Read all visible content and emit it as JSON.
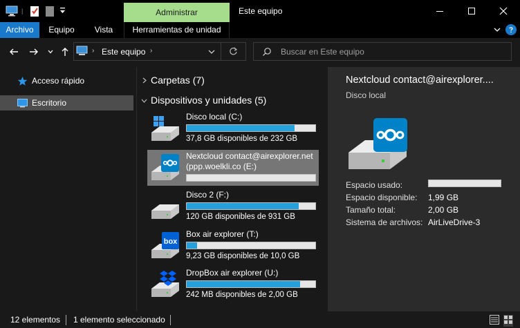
{
  "titlebar": {
    "title": "Este equipo",
    "context_tab": "Administrar",
    "icons": [
      "computer-icon",
      "properties-icon",
      "new-folder-icon",
      "customize-quick-access-icon"
    ],
    "window_buttons": [
      "minimize-icon",
      "maximize-icon",
      "close-icon"
    ]
  },
  "ribbon": {
    "tabs": [
      {
        "label": "Archivo",
        "active": true
      },
      {
        "label": "Equipo"
      },
      {
        "label": "Vista"
      },
      {
        "label": "Herramientas de unidad"
      }
    ]
  },
  "address": {
    "path_label": "Este equipo",
    "search_placeholder": "Buscar en Este equipo"
  },
  "nav": {
    "items": [
      {
        "label": "Acceso rápido",
        "icon": "star-icon"
      },
      {
        "label": "Escritorio",
        "icon": "desktop-icon",
        "selected": true
      }
    ]
  },
  "content": {
    "groups": [
      {
        "label": "Carpetas (7)",
        "expanded": false
      },
      {
        "label": "Dispositivos y unidades (5)",
        "expanded": true
      }
    ],
    "drives": [
      {
        "name": "Disco local (C:)",
        "free_text": "37,8 GB disponibles de 232 GB",
        "used_fraction": 0.84,
        "icon": "windows-drive-icon"
      },
      {
        "name": "Nextcloud contact@airexplorer.net",
        "name2": "(ppp.woelkli.co (E:)",
        "free_text": "",
        "used_fraction": 0.0,
        "selected": true,
        "icon": "nextcloud-drive-icon"
      },
      {
        "name": "Disco 2 (F:)",
        "free_text": "120 GB disponibles de 931 GB",
        "used_fraction": 0.87,
        "icon": "drive-icon"
      },
      {
        "name": "Box air explorer (T:)",
        "free_text": "9,23 GB disponibles de 10,0 GB",
        "used_fraction": 0.08,
        "icon": "box-drive-icon"
      },
      {
        "name": "DropBox air explorer (U:)",
        "free_text": "242 MB disponibles de 2,00 GB",
        "used_fraction": 0.88,
        "icon": "dropbox-drive-icon"
      }
    ]
  },
  "details": {
    "title": "Nextcloud contact@airexplorer....",
    "subtitle": "Disco local",
    "props": [
      {
        "label": "Espacio usado:",
        "value": ""
      },
      {
        "label": "Espacio disponible:",
        "value": "1,99 GB"
      },
      {
        "label": "Tamaño total:",
        "value": "2,00 GB"
      },
      {
        "label": "Sistema de archivos:",
        "value": "AirLiveDrive-3"
      }
    ],
    "used_fraction": 0.0
  },
  "status": {
    "count": "12 elementos",
    "selection": "1 elemento seleccionado"
  },
  "colors": {
    "accent": "#1979ca",
    "context_tab": "#a5dd8c",
    "bar_fill": "#26a0da",
    "nextcloud": "#0082c9",
    "box": "#0061d5",
    "dropbox": "#0061fe"
  }
}
